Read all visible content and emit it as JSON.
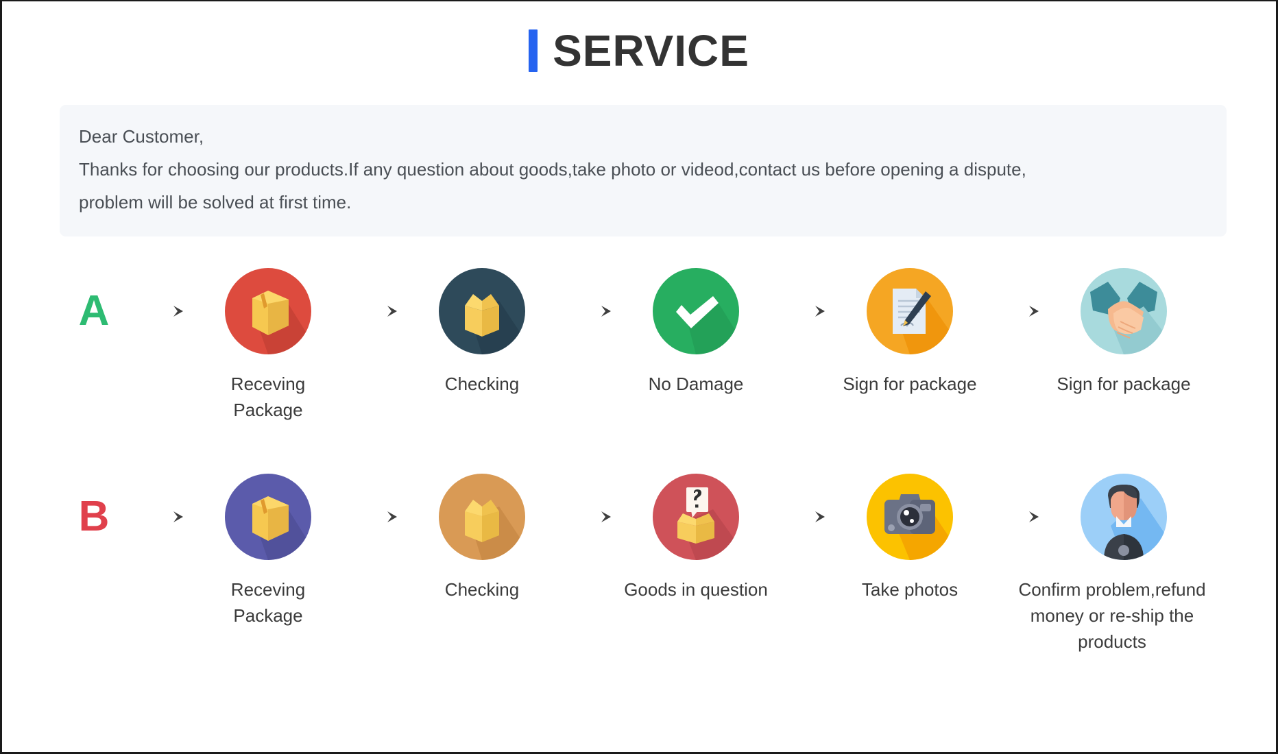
{
  "header": {
    "accent_color": "#2563f0",
    "title": "SERVICE"
  },
  "notice": {
    "line1": "Dear Customer,",
    "line2": "Thanks for choosing our products.If any question about goods,take photo or videod,contact us before opening a dispute,",
    "line3": "problem will be solved at first time."
  },
  "flows": [
    {
      "letter": "A",
      "letter_color": "#2dbb72",
      "steps": [
        {
          "icon": "package-box-icon",
          "circle_color": "#dd4b3e",
          "label": "Receving Package"
        },
        {
          "icon": "open-box-icon",
          "circle_color": "#2e4a5a",
          "label": "Checking"
        },
        {
          "icon": "check-mark-icon",
          "circle_color": "#27ae60",
          "label": "No Damage"
        },
        {
          "icon": "document-sign-icon",
          "circle_color": "#f5a623",
          "label": "Sign for package"
        },
        {
          "icon": "handshake-icon",
          "circle_color": "#a8dadd",
          "label": "Sign for package"
        }
      ]
    },
    {
      "letter": "B",
      "letter_color": "#e0404c",
      "steps": [
        {
          "icon": "package-box-icon",
          "circle_color": "#5b5bab",
          "label": "Receving Package"
        },
        {
          "icon": "open-box-icon",
          "circle_color": "#d99a55",
          "label": "Checking"
        },
        {
          "icon": "question-box-icon",
          "circle_color": "#cf5259",
          "label": "Goods in question"
        },
        {
          "icon": "camera-icon",
          "circle_color": "#fcc200",
          "label": "Take photos"
        },
        {
          "icon": "support-person-icon",
          "circle_color": "#9ccff8",
          "label": "Confirm problem,refund money or re-ship the products"
        }
      ]
    }
  ],
  "arrow": {
    "icon": "arrow-right-icon",
    "color": "#4a4a4a"
  }
}
